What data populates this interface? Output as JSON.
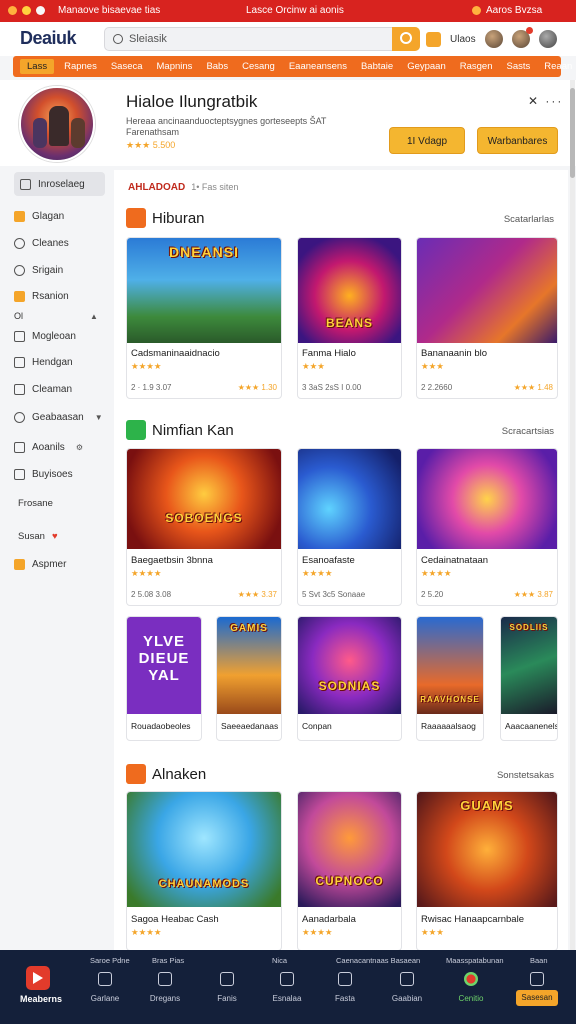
{
  "topbar": {
    "left_text": "Manaove bisaevae tias",
    "mid_text": "Lasce Orcinw ai aonis",
    "right_text": "Aaros Bvzsa",
    "dot_colors": [
      "#ffb23e",
      "#ffd23e",
      "#f7f7f7"
    ]
  },
  "header": {
    "logo": "Deaiuk",
    "search_placeholder": "Sleiasik",
    "icon_label": "Ulaos"
  },
  "catnav": [
    "Lass",
    "Rapnes",
    "Saseca",
    "Mapnins",
    "Babs",
    "Cesang",
    "Eaaneansens",
    "Babtaie",
    "Geypaan",
    "Rasgen",
    "Sasts",
    "Reaan"
  ],
  "profile": {
    "title": "Hialoe Ilungratbik",
    "desc_line1": "Hereaa ancinaanduocteptsygnes gorteseepts ŠАТ",
    "desc_line2": "Farenathsam",
    "rating": "★★★ 5.500",
    "btn1": "1І Vdagp",
    "btn2": "Warbanbares"
  },
  "sidebar": {
    "items": [
      {
        "label": "Inroselaeg"
      },
      {
        "label": "Glagan"
      },
      {
        "label": "Cleanes"
      },
      {
        "label": "Srigain"
      },
      {
        "label": "Rsanion"
      },
      {
        "label": "Ol"
      },
      {
        "label": "Mogleoan"
      },
      {
        "label": "Hendgan"
      },
      {
        "label": "Cleaman"
      },
      {
        "label": "Geabaasan"
      },
      {
        "label": "Aoanils"
      },
      {
        "label": "Buyisoes"
      },
      {
        "label": "Frosane"
      },
      {
        "label": "Susan"
      },
      {
        "label": "Aspmer"
      }
    ]
  },
  "main": {
    "crumb": "AHLADOAD",
    "crumb_small": "1• Fas siten",
    "sections": [
      {
        "title": "Hiburan",
        "link": "Scatarlarlas"
      },
      {
        "title": "Nimfian Kan",
        "link": "Scracartsias"
      },
      {
        "title": "Alnaken",
        "link": "Sonstetsakas"
      }
    ],
    "row1": [
      {
        "name": "Cadsmaninaaidnacio",
        "stars": "★★★★",
        "rate": "★★★ 1.30",
        "meta": "2 · 1.9 3.07",
        "thumb_text": "DNEANSI"
      },
      {
        "name": "Fanma Hialo",
        "stars": "★★★",
        "rate": "",
        "meta": "3 3aS 2sS I 0.00",
        "thumb_text": "BEANS"
      },
      {
        "name": "Bananaanin blo",
        "stars": "★★★",
        "rate": "★★★ 1.48",
        "meta": "2 2.2660",
        "thumb_text": ""
      }
    ],
    "row2": [
      {
        "name": "Baegaetbsin 3bnna",
        "stars": "★★★★",
        "rate": "★★★ 3.37",
        "meta": "2 5.08 3.08",
        "thumb_text": "SOBOENGS"
      },
      {
        "name": "Esanoafaste",
        "stars": "★★★★",
        "rate": "",
        "meta": "5 Svt 3c5 Sonaae",
        "thumb_text": ""
      },
      {
        "name": "Cedainatnataan",
        "stars": "★★★★",
        "rate": "★★★ 3.87",
        "meta": "2 5.20",
        "thumb_text": ""
      }
    ],
    "row3": [
      {
        "name": "Rouadaobeoles",
        "thumb_text": "YLVE DIEUE YAL"
      },
      {
        "name": "Saeeaedanaas",
        "thumb_text": "GAMIS"
      },
      {
        "name": "Conpan",
        "thumb_text": "SODNIAS"
      },
      {
        "name": "Raaaaaalsaog",
        "thumb_text": "RAAVHONSE"
      },
      {
        "name": "Aaacaanenels",
        "thumb_text": "SODLIIS"
      }
    ],
    "row4": [
      {
        "name": "Sagoa Heabac Cash",
        "stars": "★★★★",
        "thumb_text": "CHAUNAMODS"
      },
      {
        "name": "Aanadarbala",
        "stars": "★★★★",
        "thumb_text": "CUPNOCO"
      },
      {
        "name": "Rwisac Hanaapcarnbale",
        "stars": "★★★",
        "thumb_text": "GUAMS"
      }
    ]
  },
  "bottomnav": {
    "logo_label": "Meaberns",
    "top_labels": [
      "Saroe Pdne",
      "Bras Pias",
      "Nica",
      "Caenacantnaas Basaean",
      "Maasspatabunan",
      "Baan"
    ],
    "items": [
      "Garlane",
      "Dregans",
      "Fanis",
      "Esnalaa",
      "Fasta",
      "Gaabian",
      "Cenitio"
    ],
    "button": "Sasesan"
  }
}
